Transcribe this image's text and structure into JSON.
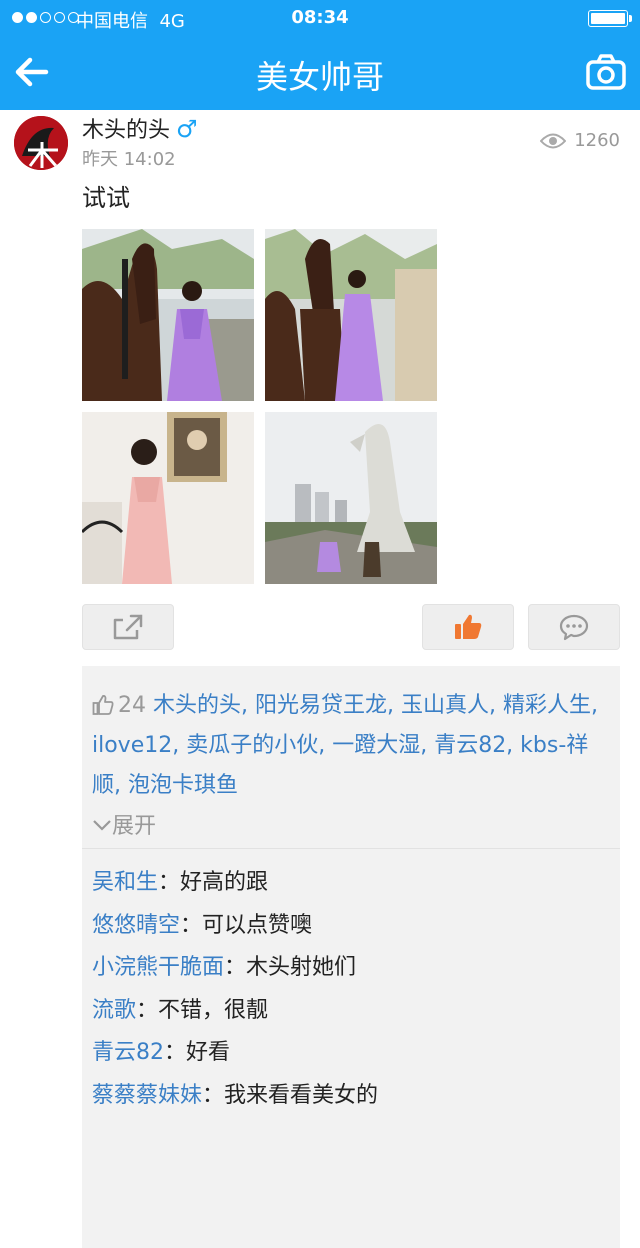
{
  "status_bar": {
    "carrier": "中国电信",
    "network": "4G",
    "time": "08:34"
  },
  "nav": {
    "title": "美女帅哥",
    "back_icon": "arrow-left-icon",
    "camera_icon": "camera-icon"
  },
  "post": {
    "username": "木头的头",
    "gender_symbol": "♂",
    "time": "昨天 14:02",
    "views": "1260",
    "content": "试试",
    "photos": [
      "photo-horse-lady-1",
      "photo-horse-lady-2",
      "photo-pink-dress",
      "photo-statue-square"
    ]
  },
  "likes": {
    "count": "24",
    "names": "木头的头, 阳光易贷王龙, 玉山真人, 精彩人生, ilove12, 卖瓜子的小伙, 一蹬大湿, 青云82, kbs-祥顺, 泡泡卡琪鱼",
    "expand_label": "展开"
  },
  "comments": [
    {
      "name": "吴和生",
      "text": "好高的跟"
    },
    {
      "name": "悠悠晴空",
      "text": "可以点赞噢"
    },
    {
      "name": "小浣熊干脆面",
      "text": "木头射她们"
    },
    {
      "name": "流歌",
      "text": "不错，很靓"
    },
    {
      "name": "青云82",
      "text": "好看"
    },
    {
      "name": "蔡蔡蔡妹妹",
      "text": "我来看看美女的"
    }
  ],
  "comment_separator": "：",
  "colors": {
    "header": "#1aa3f5",
    "link": "#3a7fc6",
    "like_active": "#f07832"
  }
}
